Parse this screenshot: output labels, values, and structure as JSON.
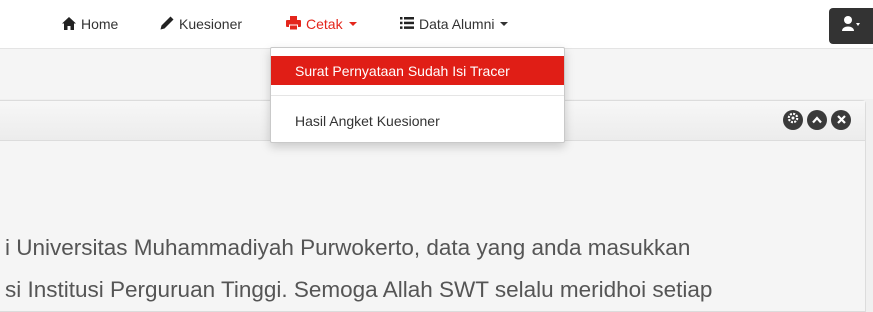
{
  "navbar": {
    "items": [
      {
        "label": "Home",
        "icon": "home-icon"
      },
      {
        "label": "Kuesioner",
        "icon": "pencil-icon"
      },
      {
        "label": "Cetak",
        "icon": "print-icon",
        "active": true
      },
      {
        "label": "Data Alumni",
        "icon": "list-icon"
      }
    ],
    "active_color": "#e4261c"
  },
  "dropdown": {
    "items": [
      {
        "label": "Surat Pernyataan Sudah Isi Tracer",
        "highlighted": true
      },
      {
        "label": "Hasil Angket Kuesioner"
      }
    ],
    "highlight_color": "#e01e16"
  },
  "content": {
    "line1": "i Universitas Muhammadiyah Purwokerto, data yang anda masukkan",
    "line2": "si Institusi Perguruan Tinggi. Semoga Allah SWT selalu meridhoi setiap"
  }
}
